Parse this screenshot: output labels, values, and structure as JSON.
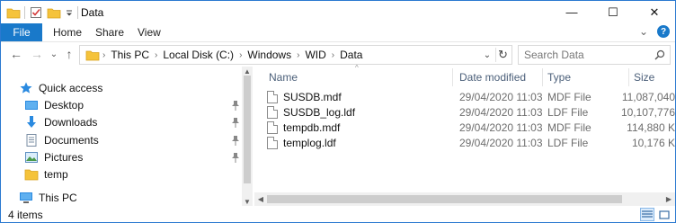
{
  "window": {
    "title": "Data",
    "buttons": {
      "minimize": "—",
      "maximize": "☐",
      "close": "✕"
    }
  },
  "ribbon": {
    "tabs": [
      "File",
      "Home",
      "Share",
      "View"
    ],
    "collapse_glyph": "⌄",
    "help_glyph": "?"
  },
  "navigation": {
    "back_glyph": "←",
    "forward_glyph": "→",
    "recent_glyph": "⌄",
    "up_glyph": "↑",
    "breadcrumb": [
      "This PC",
      "Local Disk (C:)",
      "Windows",
      "WID",
      "Data"
    ],
    "crumb_separator": "›",
    "dropdown_glyph": "⌄",
    "refresh_glyph": "↻",
    "search_placeholder": "Search Data"
  },
  "sidebar": {
    "items": [
      {
        "label": "Quick access",
        "icon": "star-icon",
        "pinned": false
      },
      {
        "label": "Desktop",
        "icon": "desktop-icon",
        "pinned": true
      },
      {
        "label": "Downloads",
        "icon": "download-icon",
        "pinned": true
      },
      {
        "label": "Documents",
        "icon": "documents-icon",
        "pinned": true
      },
      {
        "label": "Pictures",
        "icon": "pictures-icon",
        "pinned": true
      },
      {
        "label": "temp",
        "icon": "folder-icon",
        "pinned": false
      },
      {
        "label": "This PC",
        "icon": "computer-icon",
        "pinned": false
      }
    ],
    "pin_glyph": "📌",
    "scroll_up_glyph": "▲",
    "scroll_down_glyph": "▼"
  },
  "file_list": {
    "columns": [
      "Name",
      "Date modified",
      "Type",
      "Size"
    ],
    "sort_glyph": "^",
    "rows": [
      {
        "name": "SUSDB.mdf",
        "date": "29/04/2020 11:03",
        "type": "MDF File",
        "size": "11,087,040"
      },
      {
        "name": "SUSDB_log.ldf",
        "date": "29/04/2020 11:03",
        "type": "LDF File",
        "size": "10,107,776"
      },
      {
        "name": "tempdb.mdf",
        "date": "29/04/2020 11:03",
        "type": "MDF File",
        "size": "114,880 K"
      },
      {
        "name": "templog.ldf",
        "date": "29/04/2020 11:03",
        "type": "LDF File",
        "size": "10,176 K"
      }
    ],
    "hscroll_left_glyph": "◀",
    "hscroll_right_glyph": "▶"
  },
  "status": {
    "item_count": "4 items"
  },
  "colors": {
    "accent": "#1979ca",
    "folder": "#f5c33b",
    "header_text": "#4c607a"
  }
}
